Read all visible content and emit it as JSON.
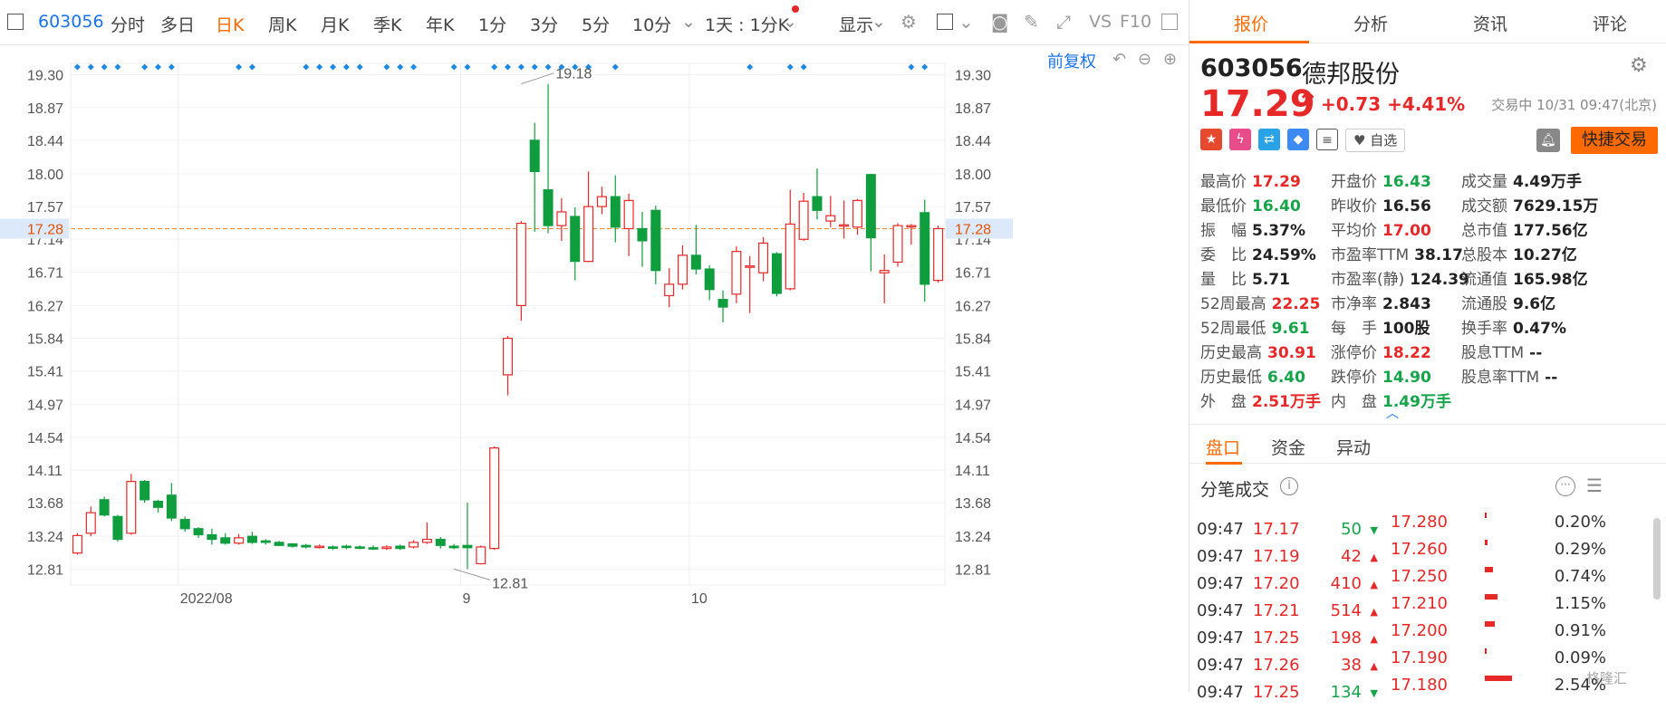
{
  "toolbar": {
    "code": "603056",
    "tabs": [
      "分时",
      "多日",
      "日K",
      "周K",
      "月K",
      "季K",
      "年K",
      "1分",
      "3分",
      "5分",
      "10分"
    ],
    "active_tab": "日K",
    "period_select": "1天 : 1分K",
    "display_select": "显示",
    "vs_label": "VS",
    "f10_label": "F10"
  },
  "chart_header": {
    "restore_label": "前复权"
  },
  "chart_data": {
    "type": "candlestick",
    "title": "",
    "ylim": [
      12.6,
      19.45
    ],
    "yticks": [
      19.3,
      18.87,
      18.44,
      18.0,
      17.57,
      17.14,
      16.71,
      16.27,
      15.84,
      15.41,
      14.97,
      14.54,
      14.11,
      13.68,
      13.24,
      12.81
    ],
    "ytick_labels": [
      "19.30",
      "18.87",
      "18.44",
      "18.00",
      "17.57",
      "17.14",
      "16.71",
      "16.27",
      "15.84",
      "15.41",
      "14.97",
      "14.54",
      "14.11",
      "13.68",
      "13.24",
      "12.81"
    ],
    "xlabels": [
      "2022/08",
      "9",
      "10"
    ],
    "xlabel_index": [
      8,
      29,
      46
    ],
    "current_price_label": "17.28",
    "current_price": 17.28,
    "max_label": "19.18",
    "max_value": 19.18,
    "max_index": 33,
    "min_label": "12.81",
    "min_value": 12.81,
    "min_index": 28,
    "markers": [
      0,
      1,
      2,
      3,
      5,
      6,
      7,
      12,
      13,
      17,
      18,
      19,
      20,
      21,
      23,
      24,
      25,
      28,
      29,
      31,
      32,
      33,
      34,
      35,
      36,
      37,
      38,
      40,
      50,
      53,
      54,
      62,
      63
    ],
    "ohlc": [
      [
        13.02,
        13.25,
        13.28,
        13.0
      ],
      [
        13.28,
        13.55,
        13.63,
        13.24
      ],
      [
        13.72,
        13.52,
        13.76,
        13.5
      ],
      [
        13.5,
        13.2,
        13.52,
        13.17
      ],
      [
        13.28,
        13.96,
        14.06,
        13.26
      ],
      [
        13.96,
        13.72,
        13.98,
        13.68
      ],
      [
        13.7,
        13.62,
        13.72,
        13.55
      ],
      [
        13.78,
        13.48,
        13.94,
        13.44
      ],
      [
        13.46,
        13.34,
        13.5,
        13.3
      ],
      [
        13.34,
        13.26,
        13.36,
        13.22
      ],
      [
        13.26,
        13.2,
        13.34,
        13.13
      ],
      [
        13.22,
        13.15,
        13.28,
        13.13
      ],
      [
        13.15,
        13.22,
        13.27,
        13.13
      ],
      [
        13.24,
        13.16,
        13.3,
        13.14
      ],
      [
        13.18,
        13.16,
        13.2,
        13.13
      ],
      [
        13.16,
        13.12,
        13.18,
        13.11
      ],
      [
        13.14,
        13.11,
        13.15,
        13.09
      ],
      [
        13.12,
        13.1,
        13.14,
        13.08
      ],
      [
        13.1,
        13.11,
        13.13,
        13.08
      ],
      [
        13.1,
        13.09,
        13.12,
        13.06
      ],
      [
        13.11,
        13.1,
        13.13,
        13.07
      ],
      [
        13.1,
        13.09,
        13.12,
        13.07
      ],
      [
        13.09,
        13.08,
        13.12,
        13.06
      ],
      [
        13.08,
        13.1,
        13.12,
        13.06
      ],
      [
        13.11,
        13.08,
        13.13,
        13.06
      ],
      [
        13.1,
        13.16,
        13.19,
        13.08
      ],
      [
        13.16,
        13.2,
        13.42,
        13.14
      ],
      [
        13.2,
        13.12,
        13.23,
        13.08
      ],
      [
        13.11,
        13.09,
        13.14,
        13.07
      ],
      [
        13.12,
        13.09,
        13.68,
        12.81
      ],
      [
        12.88,
        13.1,
        13.12,
        12.87
      ],
      [
        13.08,
        14.4,
        14.42,
        13.06
      ],
      [
        15.36,
        15.84,
        15.87,
        15.09
      ],
      [
        16.27,
        17.35,
        17.38,
        16.07
      ],
      [
        18.44,
        18.03,
        18.67,
        17.24
      ],
      [
        17.79,
        17.32,
        19.18,
        17.22
      ],
      [
        17.32,
        17.5,
        17.68,
        17.12
      ],
      [
        17.44,
        16.85,
        17.56,
        16.6
      ],
      [
        16.85,
        17.57,
        18.03,
        16.84
      ],
      [
        17.57,
        17.7,
        17.83,
        17.47
      ],
      [
        17.7,
        17.3,
        17.98,
        17.1
      ],
      [
        17.28,
        17.65,
        17.74,
        16.92
      ],
      [
        17.28,
        17.12,
        17.5,
        16.78
      ],
      [
        17.52,
        16.73,
        17.58,
        16.55
      ],
      [
        16.4,
        16.55,
        16.76,
        16.25
      ],
      [
        16.55,
        16.93,
        17.06,
        16.48
      ],
      [
        16.93,
        16.75,
        17.33,
        16.68
      ],
      [
        16.75,
        16.48,
        16.8,
        16.34
      ],
      [
        16.35,
        16.25,
        16.47,
        16.05
      ],
      [
        16.42,
        16.98,
        17.05,
        16.3
      ],
      [
        16.79,
        16.79,
        16.92,
        16.17
      ],
      [
        16.7,
        17.09,
        17.17,
        16.59
      ],
      [
        16.95,
        16.43,
        16.97,
        16.39
      ],
      [
        16.49,
        17.34,
        17.79,
        16.47
      ],
      [
        17.14,
        17.64,
        17.75,
        17.12
      ],
      [
        17.7,
        17.52,
        18.07,
        17.4
      ],
      [
        17.38,
        17.45,
        17.71,
        17.3
      ],
      [
        17.33,
        17.33,
        17.65,
        17.15
      ],
      [
        17.3,
        17.65,
        17.67,
        17.2
      ],
      [
        17.99,
        17.16,
        18.0,
        16.72
      ],
      [
        16.7,
        16.73,
        16.94,
        16.3
      ],
      [
        16.84,
        17.32,
        17.35,
        16.78
      ],
      [
        17.32,
        17.32,
        17.34,
        17.07
      ],
      [
        17.49,
        16.55,
        17.66,
        16.32
      ],
      [
        16.6,
        17.28,
        17.32,
        16.57
      ]
    ]
  },
  "panel": {
    "tabs": [
      "报价",
      "分析",
      "资讯",
      "评论"
    ],
    "active_tab": "报价",
    "code": "603056",
    "name": "德邦股份",
    "price": "17.29",
    "change": "+0.73",
    "change_pct": "+4.41%",
    "status": "交易中 10/31 09:47(北京)",
    "watch_label": "自选",
    "quick_trade": "快捷交易",
    "quote_rows": [
      [
        [
          "最高价",
          "17.29",
          "red"
        ],
        [
          "开盘价",
          "16.43",
          "green"
        ],
        [
          "成交量",
          "4.49万手",
          "dark"
        ]
      ],
      [
        [
          "最低价",
          "16.40",
          "green"
        ],
        [
          "昨收价",
          "16.56",
          "dark"
        ],
        [
          "成交额",
          "7629.15万",
          "dark"
        ]
      ],
      [
        [
          "振　幅",
          "5.37%",
          "dark"
        ],
        [
          "平均价",
          "17.00",
          "red"
        ],
        [
          "总市值",
          "177.56亿",
          "dark"
        ]
      ],
      [
        [
          "委　比",
          "24.59%",
          "dark"
        ],
        [
          "市盈率TTM",
          "38.17",
          "dark"
        ],
        [
          "总股本",
          "10.27亿",
          "dark"
        ]
      ],
      [
        [
          "量　比",
          "5.71",
          "dark"
        ],
        [
          "市盈率(静)",
          "124.39",
          "dark"
        ],
        [
          "流通值",
          "165.98亿",
          "dark"
        ]
      ],
      [
        [
          "52周最高",
          "22.25",
          "red"
        ],
        [
          "市净率",
          "2.843",
          "dark"
        ],
        [
          "流通股",
          "9.6亿",
          "dark"
        ]
      ],
      [
        [
          "52周最低",
          "9.61",
          "green"
        ],
        [
          "每　手",
          "100股",
          "dark"
        ],
        [
          "换手率",
          "0.47%",
          "dark"
        ]
      ],
      [
        [
          "历史最高",
          "30.91",
          "red"
        ],
        [
          "涨停价",
          "18.22",
          "red"
        ],
        [
          "股息TTM",
          "--",
          "dark"
        ]
      ],
      [
        [
          "历史最低",
          "6.40",
          "green"
        ],
        [
          "跌停价",
          "14.90",
          "green"
        ],
        [
          "股息率TTM",
          "--",
          "dark"
        ]
      ],
      [
        [
          "外　盘",
          "2.51万手",
          "red"
        ],
        [
          "内　盘",
          "1.49万手",
          "green"
        ],
        [
          "",
          "",
          "dark"
        ]
      ]
    ],
    "subtabs": [
      "盘口",
      "资金",
      "异动"
    ],
    "ticks_title": "分笔成交",
    "trades": [
      {
        "time": "09:47",
        "price": "17.17",
        "vol": "50",
        "dir": "down"
      },
      {
        "time": "09:47",
        "price": "17.19",
        "vol": "42",
        "dir": "up"
      },
      {
        "time": "09:47",
        "price": "17.20",
        "vol": "410",
        "dir": "up"
      },
      {
        "time": "09:47",
        "price": "17.21",
        "vol": "514",
        "dir": "up"
      },
      {
        "time": "09:47",
        "price": "17.25",
        "vol": "198",
        "dir": "up"
      },
      {
        "time": "09:47",
        "price": "17.26",
        "vol": "38",
        "dir": "up"
      },
      {
        "time": "09:47",
        "price": "17.25",
        "vol": "134",
        "dir": "down"
      }
    ],
    "depth": [
      {
        "price": "17.280",
        "pct": "0.20%",
        "share": 0.2
      },
      {
        "price": "17.260",
        "pct": "0.29%",
        "share": 0.29
      },
      {
        "price": "17.250",
        "pct": "0.74%",
        "share": 0.74
      },
      {
        "price": "17.210",
        "pct": "1.15%",
        "share": 1.15
      },
      {
        "price": "17.200",
        "pct": "0.91%",
        "share": 0.91
      },
      {
        "price": "17.190",
        "pct": "0.09%",
        "share": 0.09
      },
      {
        "price": "17.180",
        "pct": "2.54%",
        "share": 2.54
      }
    ],
    "watermark": "格隆汇"
  }
}
